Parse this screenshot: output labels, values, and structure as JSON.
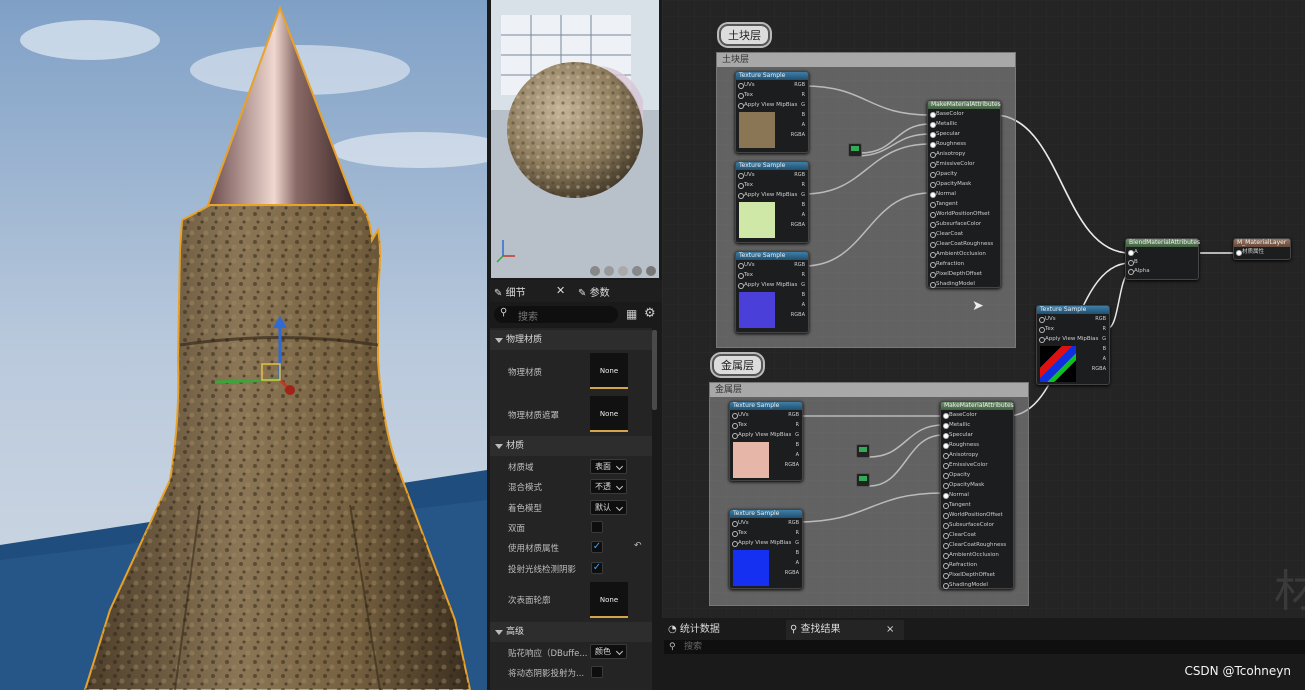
{
  "graph": {
    "comment_soil": {
      "bubble": "土块层",
      "header": "土块层"
    },
    "comment_metal": {
      "bubble": "金属层",
      "header": "金属层"
    },
    "texture_sample_title": "Texture Sample",
    "texture_pins_left": [
      "UVs",
      "Tex",
      "Apply View MipBias"
    ],
    "texture_pins_right": [
      "RGB",
      "R",
      "G",
      "B",
      "A",
      "RGBA"
    ],
    "make_attributes_title": "MakeMaterialAttributes",
    "make_attributes_pins": [
      "BaseColor",
      "Metallic",
      "Specular",
      "Roughness",
      "Anisotropy",
      "EmissiveColor",
      "Opacity",
      "OpacityMask",
      "Normal",
      "Tangent",
      "WorldPositionOffset",
      "SubsurfaceColor",
      "ClearCoat",
      "ClearCoatRoughness",
      "AmbientOcclusion",
      "Refraction",
      "PixelDepthOffset",
      "ShadingModel"
    ],
    "blend_title": "BlendMaterialAttributes",
    "blend_pins": [
      "A",
      "B",
      "Alpha"
    ],
    "output_title": "M_MaterialLayer",
    "output_pin": "材质属性",
    "corner_glyph": "材",
    "colors": {
      "soil_swatch": "#8a7555",
      "green_swatch": "#cfe8a8",
      "normal_swatch": "#4a3fd8",
      "pink_swatch": "#e6b7a8",
      "blue_swatch": "#1530f0"
    }
  },
  "details": {
    "tabs": [
      {
        "label": "细节",
        "icon": "pencil-icon"
      },
      {
        "label": "参数",
        "icon": "pencil-icon"
      }
    ],
    "search_placeholder": "搜索",
    "sections": {
      "physical": "物理材质",
      "material": "材质",
      "advanced": "高级"
    },
    "props": {
      "phys_material": "物理材质",
      "phys_mask": "物理材质遮罩",
      "domain": "材质域",
      "blend_mode": "混合模式",
      "shading_model": "着色模型",
      "two_sided": "双面",
      "use_attributes": "使用材质属性",
      "ray_shadow": "投射光线检测阴影",
      "subsurface": "次表面轮廓",
      "decal": "贴花响应（DBuffe...",
      "dynamic_shadow": "将动态阴影投射为..."
    },
    "none_label": "None",
    "values": {
      "domain": "表面",
      "blend_mode": "不透",
      "shading_model": "默认",
      "decal": "颜色"
    },
    "checks": {
      "two_sided": false,
      "use_attributes": true,
      "ray_shadow": true
    }
  },
  "bottom": {
    "tabs": [
      {
        "label": "统计数据",
        "icon": "stats-icon"
      },
      {
        "label": "查找结果",
        "icon": "search-icon"
      }
    ],
    "search_placeholder": "搜索",
    "close": "×"
  },
  "watermark": "CSDN @Tcohneyn"
}
